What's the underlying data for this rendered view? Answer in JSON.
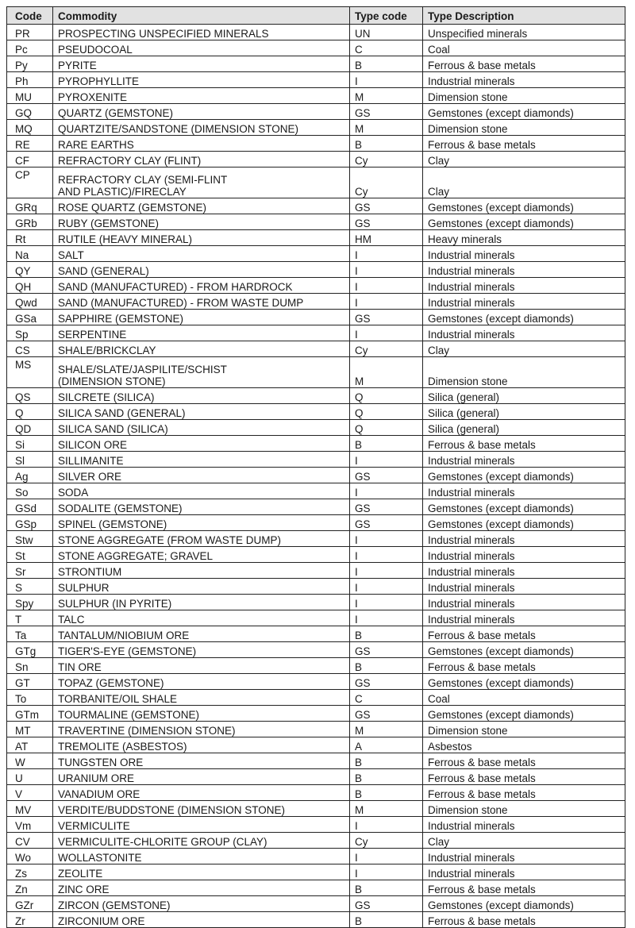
{
  "table": {
    "headers": [
      "Code",
      "Commodity",
      "Type code",
      "Type Description"
    ],
    "rows": [
      [
        "PR",
        "PROSPECTING UNSPECIFIED MINERALS",
        "UN",
        "Unspecified minerals"
      ],
      [
        "Pc",
        "PSEUDOCOAL",
        "C",
        "Coal"
      ],
      [
        "Py",
        "PYRITE",
        "B",
        "Ferrous & base metals"
      ],
      [
        "Ph",
        "PYROPHYLLITE",
        "I",
        "Industrial minerals"
      ],
      [
        "MU",
        "PYROXENITE",
        "M",
        "Dimension stone"
      ],
      [
        "GQ",
        "QUARTZ (GEMSTONE)",
        "GS",
        "Gemstones (except diamonds)"
      ],
      [
        "MQ",
        "QUARTZITE/SANDSTONE (DIMENSION STONE)",
        "M",
        "Dimension stone"
      ],
      [
        "RE",
        "RARE EARTHS",
        "B",
        "Ferrous & base metals"
      ],
      [
        "CF",
        "REFRACTORY CLAY (FLINT)",
        "Cy",
        "Clay"
      ],
      [
        "CP",
        "REFRACTORY CLAY (SEMI-FLINT\nAND PLASTIC)/FIRECLAY",
        "Cy",
        "Clay"
      ],
      [
        "GRq",
        "ROSE QUARTZ (GEMSTONE)",
        "GS",
        "Gemstones (except diamonds)"
      ],
      [
        "GRb",
        "RUBY (GEMSTONE)",
        "GS",
        "Gemstones (except diamonds)"
      ],
      [
        "Rt",
        "RUTILE (HEAVY MINERAL)",
        "HM",
        "Heavy minerals"
      ],
      [
        "Na",
        "SALT",
        "I",
        "Industrial minerals"
      ],
      [
        "QY",
        "SAND (GENERAL)",
        "I",
        "Industrial minerals"
      ],
      [
        "QH",
        "SAND (MANUFACTURED) - FROM HARDROCK",
        "I",
        "Industrial minerals"
      ],
      [
        "Qwd",
        "SAND (MANUFACTURED) - FROM WASTE DUMP",
        "I",
        "Industrial minerals"
      ],
      [
        "GSa",
        "SAPPHIRE (GEMSTONE)",
        "GS",
        "Gemstones (except diamonds)"
      ],
      [
        "Sp",
        "SERPENTINE",
        "I",
        "Industrial minerals"
      ],
      [
        "CS",
        "SHALE/BRICKCLAY",
        "Cy",
        "Clay"
      ],
      [
        "MS",
        "SHALE/SLATE/JASPILITE/SCHIST\n(DIMENSION STONE)",
        "M",
        "Dimension stone"
      ],
      [
        "QS",
        "SILCRETE (SILICA)",
        "Q",
        "Silica (general)"
      ],
      [
        "Q",
        "SILICA SAND (GENERAL)",
        "Q",
        "Silica (general)"
      ],
      [
        "QD",
        "SILICA SAND (SILICA)",
        "Q",
        "Silica (general)"
      ],
      [
        "Si",
        "SILICON ORE",
        "B",
        "Ferrous & base metals"
      ],
      [
        "Sl",
        "SILLIMANITE",
        "I",
        "Industrial minerals"
      ],
      [
        "Ag",
        "SILVER ORE",
        "GS",
        "Gemstones (except diamonds)"
      ],
      [
        "So",
        "SODA",
        "I",
        "Industrial minerals"
      ],
      [
        "GSd",
        "SODALITE (GEMSTONE)",
        "GS",
        "Gemstones (except diamonds)"
      ],
      [
        "GSp",
        "SPINEL (GEMSTONE)",
        "GS",
        "Gemstones (except diamonds)"
      ],
      [
        "Stw",
        "STONE AGGREGATE (FROM WASTE DUMP)",
        "I",
        "Industrial minerals"
      ],
      [
        "St",
        "STONE AGGREGATE; GRAVEL",
        "I",
        "Industrial minerals"
      ],
      [
        "Sr",
        "STRONTIUM",
        "I",
        "Industrial minerals"
      ],
      [
        "S",
        "SULPHUR",
        "I",
        "Industrial minerals"
      ],
      [
        "Spy",
        "SULPHUR (IN PYRITE)",
        "I",
        "Industrial minerals"
      ],
      [
        "T",
        "TALC",
        "I",
        "Industrial minerals"
      ],
      [
        "Ta",
        "TANTALUM/NIOBIUM ORE",
        "B",
        "Ferrous & base metals"
      ],
      [
        "GTg",
        "TIGER'S-EYE (GEMSTONE)",
        "GS",
        "Gemstones (except diamonds)"
      ],
      [
        "Sn",
        "TIN ORE",
        "B",
        "Ferrous & base metals"
      ],
      [
        "GT",
        "TOPAZ (GEMSTONE)",
        "GS",
        "Gemstones (except diamonds)"
      ],
      [
        "To",
        "TORBANITE/OIL SHALE",
        "C",
        "Coal"
      ],
      [
        "GTm",
        "TOURMALINE (GEMSTONE)",
        "GS",
        "Gemstones (except diamonds)"
      ],
      [
        "MT",
        "TRAVERTINE (DIMENSION STONE)",
        "M",
        "Dimension stone"
      ],
      [
        "AT",
        "TREMOLITE (ASBESTOS)",
        "A",
        "Asbestos"
      ],
      [
        "W",
        "TUNGSTEN ORE",
        "B",
        "Ferrous & base metals"
      ],
      [
        "U",
        "URANIUM ORE",
        "B",
        "Ferrous & base metals"
      ],
      [
        "V",
        "VANADIUM ORE",
        "B",
        "Ferrous & base metals"
      ],
      [
        "MV",
        "VERDITE/BUDDSTONE (DIMENSION STONE)",
        "M",
        "Dimension stone"
      ],
      [
        "Vm",
        "VERMICULITE",
        "I",
        "Industrial minerals"
      ],
      [
        "CV",
        "VERMICULITE-CHLORITE GROUP (CLAY)",
        "Cy",
        "Clay"
      ],
      [
        "Wo",
        "WOLLASTONITE",
        "I",
        "Industrial minerals"
      ],
      [
        "Zs",
        "ZEOLITE",
        "I",
        "Industrial minerals"
      ],
      [
        "Zn",
        "ZINC ORE",
        "B",
        "Ferrous & base metals"
      ],
      [
        "GZr",
        "ZIRCON (GEMSTONE)",
        "GS",
        "Gemstones (except diamonds)"
      ],
      [
        "Zr",
        "ZIRCONIUM ORE",
        "B",
        "Ferrous & base metals"
      ]
    ]
  }
}
